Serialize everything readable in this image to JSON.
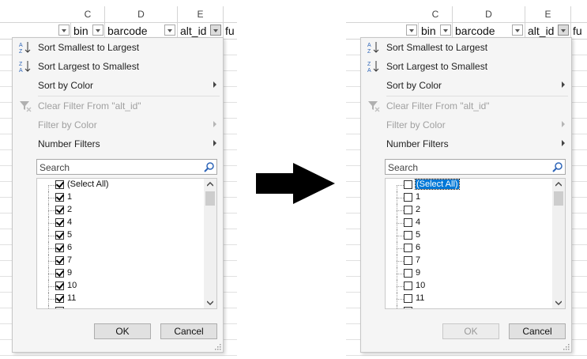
{
  "left": {
    "column_letters": [
      "C",
      "D",
      "E"
    ],
    "headers": [
      "bin",
      "barcode",
      "alt_id",
      "fu"
    ],
    "menu": {
      "sort_asc": "Sort Smallest to Largest",
      "sort_desc": "Sort Largest to Smallest",
      "sort_by_color": "Sort by Color",
      "clear_filter": "Clear Filter From \"alt_id\"",
      "filter_by_color": "Filter by Color",
      "number_filters": "Number Filters",
      "search_placeholder": "Search",
      "items": [
        {
          "label": "(Select All)",
          "checked": true
        },
        {
          "label": "1",
          "checked": true
        },
        {
          "label": "2",
          "checked": true
        },
        {
          "label": "4",
          "checked": true
        },
        {
          "label": "5",
          "checked": true
        },
        {
          "label": "6",
          "checked": true
        },
        {
          "label": "7",
          "checked": true
        },
        {
          "label": "9",
          "checked": true
        },
        {
          "label": "10",
          "checked": true
        },
        {
          "label": "11",
          "checked": true
        }
      ],
      "ok_label": "OK",
      "cancel_label": "Cancel"
    }
  },
  "right": {
    "column_letters": [
      "C",
      "D",
      "E"
    ],
    "headers": [
      "bin",
      "barcode",
      "alt_id",
      "fu"
    ],
    "menu": {
      "sort_asc": "Sort Smallest to Largest",
      "sort_desc": "Sort Largest to Smallest",
      "sort_by_color": "Sort by Color",
      "clear_filter": "Clear Filter From \"alt_id\"",
      "filter_by_color": "Filter by Color",
      "number_filters": "Number Filters",
      "search_placeholder": "Search",
      "items": [
        {
          "label": "(Select All)",
          "checked": false
        },
        {
          "label": "1",
          "checked": false
        },
        {
          "label": "2",
          "checked": false
        },
        {
          "label": "4",
          "checked": false
        },
        {
          "label": "5",
          "checked": false
        },
        {
          "label": "6",
          "checked": false
        },
        {
          "label": "7",
          "checked": false
        },
        {
          "label": "9",
          "checked": false
        },
        {
          "label": "10",
          "checked": false
        },
        {
          "label": "11",
          "checked": false
        }
      ],
      "ok_label": "OK",
      "cancel_label": "Cancel"
    }
  },
  "colors": {
    "accent": "#0078d7",
    "arrow": "#000000"
  }
}
